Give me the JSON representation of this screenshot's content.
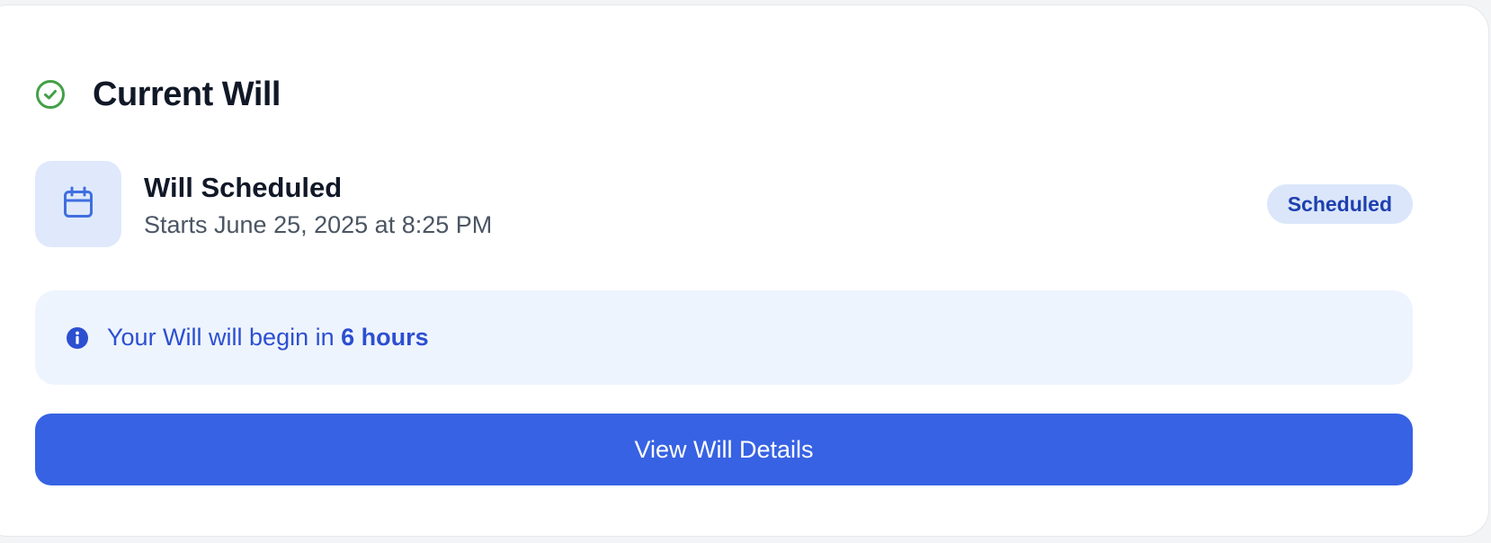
{
  "card": {
    "title": "Current Will",
    "status_icon": "check-circle-icon"
  },
  "schedule": {
    "icon": "calendar-icon",
    "title": "Will Scheduled",
    "subtitle": "Starts June 25, 2025 at 8:25 PM",
    "badge": "Scheduled"
  },
  "notice": {
    "icon": "info-icon",
    "prefix": "Your Will will begin in ",
    "highlight": "6 hours"
  },
  "actions": {
    "view_details_label": "View Will Details"
  },
  "colors": {
    "success": "#43a047",
    "accent": "#3762e3",
    "badge_bg": "#dbe6fa",
    "badge_text": "#1e40af",
    "notice_bg": "#eef4fd",
    "notice_text": "#2c4fd1"
  }
}
